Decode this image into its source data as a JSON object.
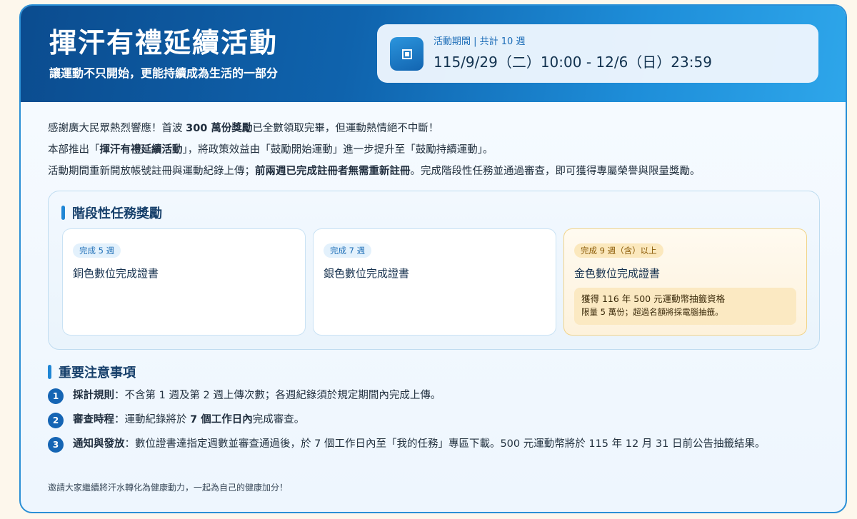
{
  "header": {
    "title": "揮汗有禮延續活動",
    "subtitle": "讓運動不只開始，更能持續成為生活的一部分",
    "period_label": "活動期間 | 共計 10 週",
    "period_dates": "115/9/29（二）10:00 - 12/6（日）23:59",
    "period_icon": "square-icon"
  },
  "intro": {
    "line1_a": "感謝廣大民眾熱烈響應！首波 ",
    "line1_b": "300 萬份獎勵",
    "line1_c": "已全數領取完畢，但運動熱情絕不中斷！",
    "line2_a": "本部推出「",
    "line2_b": "揮汗有禮延續活動",
    "line2_c": "」，將政策效益由「鼓勵開始運動」進一步提升至「鼓勵持續運動」。",
    "line3_a": "活動期間重新開放帳號註冊與運動紀錄上傳；",
    "line3_b": "前兩週已完成註冊者無需重新註冊",
    "line3_c": "。完成階段性任務並通過審查，即可獲得專屬榮譽與限量獎勵。"
  },
  "tasks": {
    "title": "階段性任務獎勵",
    "rewards": [
      {
        "badge": "完成 5 週",
        "name": "銅色數位完成證書"
      },
      {
        "badge": "完成 7 週",
        "name": "銀色數位完成證書"
      },
      {
        "badge": "完成 9 週（含）以上",
        "name": "金色數位完成證書",
        "note_line1": "獲得 116 年 500 元運動幣抽籤資格",
        "note_line2": "限量 5 萬份；超過名額將採電腦抽籤。"
      }
    ]
  },
  "notice": {
    "title": "重要注意事項",
    "items": [
      {
        "num": "1",
        "label": "採計規則",
        "text": "：不含第 1 週及第 2 週上傳次數；各週紀錄須於規定期間內完成上傳。"
      },
      {
        "num": "2",
        "label": "審查時程",
        "text_a": "：運動紀錄將於 ",
        "bold": "7 個工作日內",
        "text_b": "完成審查。"
      },
      {
        "num": "3",
        "label": "通知與發放",
        "text": "：數位證書達指定週數並審查通過後，於 7 個工作日內至「我的任務」專區下載。500 元運動幣將於 115 年 12 月 31 日前公告抽籤結果。"
      }
    ]
  },
  "closing": "邀請大家繼續將汗水轉化為健康動力，一起為自己的健康加分！",
  "colors": {
    "accent": "#1565b4",
    "hero_start": "#0b4c8f",
    "hero_end": "#2ea6ea",
    "gold_bg": "#fdf2dc",
    "gold_badge": "#fbe8bd"
  }
}
